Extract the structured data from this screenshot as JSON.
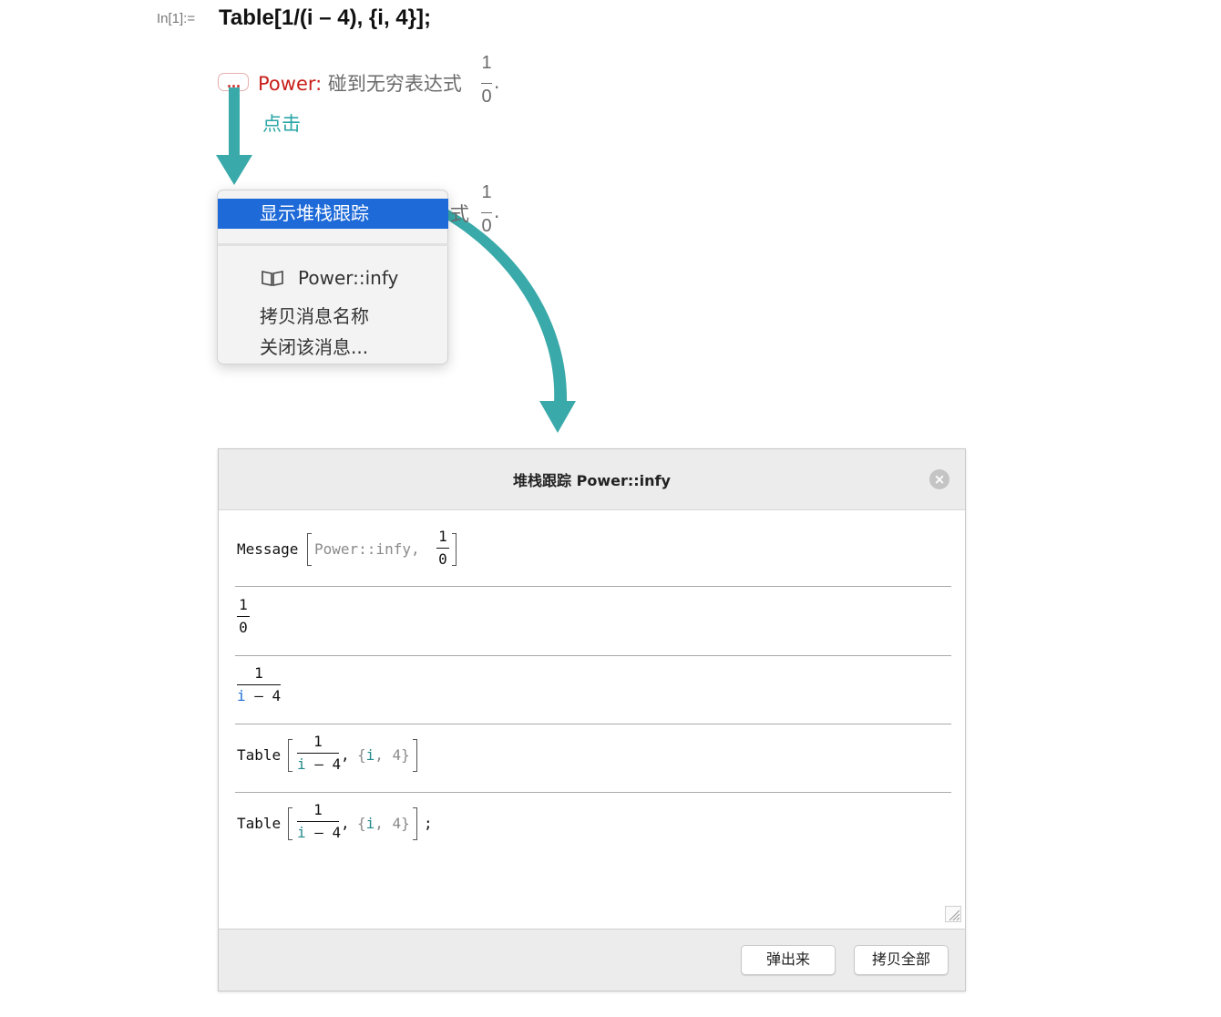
{
  "notebook": {
    "input_label": "In[1]:=",
    "input_code": "Table[1/(i – 4), {i, 4}];"
  },
  "message": {
    "name": "Power",
    "colon": ":",
    "text": "碰到无穷表达式",
    "frac_num": "1",
    "frac_den": "0",
    "period": ".",
    "obscured_text": "式"
  },
  "annotation": {
    "click_label": "点击",
    "arrow_color": "#3aa9a9"
  },
  "context_menu": {
    "items": [
      {
        "label": "显示堆栈跟踪",
        "highlighted": true
      },
      {
        "label": "Power::infy",
        "icon": "book-icon"
      },
      {
        "label": "拷贝消息名称"
      },
      {
        "label": "关闭该消息..."
      }
    ]
  },
  "dialog": {
    "title": "堆栈跟踪 Power::infy",
    "close_icon": "close-circle-icon",
    "rows": [
      {
        "head": "Message",
        "arg": "Power::infy,",
        "num": "1",
        "den": "0"
      },
      {
        "num": "1",
        "den": "0"
      },
      {
        "num": "1",
        "den_var": "i",
        "den_rest": "– 4"
      },
      {
        "head": "Table",
        "num": "1",
        "den_var": "i",
        "den_rest": "– 4",
        "iter_open": "{",
        "iter_var": "i",
        "iter_rest": ", 4}",
        "comma": ","
      },
      {
        "head": "Table",
        "num": "1",
        "den_var": "i",
        "den_rest": "– 4",
        "iter_open": "{",
        "iter_var": "i",
        "iter_rest": ", 4}",
        "comma": ",",
        "tail": ";"
      }
    ],
    "buttons": {
      "popout": "弹出来",
      "copy_all": "拷贝全部"
    }
  }
}
